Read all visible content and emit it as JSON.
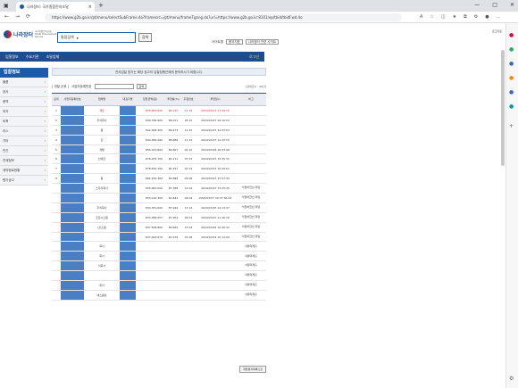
{
  "browser": {
    "tab_title": "나라장터: 국가종합전자조달",
    "url": "https://www.g2b.go.kr/pt/menu/selectSubFrame.do?framesrc=/pt/menu/frameTgong.do?url=https://www.g2b.go.kr:8101/ep/tbid/tbidFwd.do"
  },
  "header": {
    "logo_name": "나라장터",
    "logo_sub": "국가종합전자조달 Public Procurement Service",
    "search_option": "통합검색",
    "search_button": "검색",
    "logout": "로그아웃",
    "site_label": "·사이트맵",
    "site_select1": "용국지표",
    "site_select2": "나라장터 관련 사이트"
  },
  "nav": {
    "items": [
      "입찰정보",
      "수요기관",
      "조달업체"
    ],
    "right": "로그인"
  },
  "sidebar": {
    "title": "입찰정보",
    "items": [
      "물품",
      "공사",
      "용역",
      "외자",
      "비축",
      "리스",
      "기타",
      "민간",
      "연계정보",
      "계약완료현황",
      "평가공고"
    ]
  },
  "notice": "전자입찰 참가는 해당 공고의 입찰집행관에게 문의하시기 바랍니다.",
  "toolbar": {
    "sort_label": "[ 개찰 순위 ]",
    "filter_label": "사업자등록번호",
    "search_btn": "검색",
    "count_label": "[검색건수 : 20건]"
  },
  "table": {
    "headers": [
      "순위",
      "사업자등록번호",
      "업체명",
      "대표자명",
      "입찰금액(원)",
      "투찰률(%)",
      "추첨번호",
      "투찰일시",
      "비고"
    ],
    "rows": [
      {
        "rank": "1",
        "reg": "",
        "firm": "계토",
        "rep": "",
        "amt": "835,823,000",
        "rate": "86.125",
        "lot": "11 15",
        "date": "2024/03/27 17:49:15",
        "note": ""
      },
      {
        "rank": "2",
        "reg": "",
        "firm": "주식회사",
        "rep": "",
        "amt": "840,780,900",
        "rate": "86.011",
        "lot": "05 12",
        "date": "2024/03/27 16:10:03",
        "note": ""
      },
      {
        "rank": "3",
        "reg": "",
        "firm": "원",
        "rep": "",
        "amt": "842,306,300",
        "rate": "86.473",
        "lot": "12 15",
        "date": "2024/03/27 12:53:03",
        "note": ""
      },
      {
        "rank": "4",
        "reg": "",
        "firm": "단",
        "rep": "",
        "amt": "844,384,290",
        "rate": "86.686",
        "lot": "11 15",
        "date": "2024/03/27 11:32:15",
        "note": ""
      },
      {
        "rank": "5",
        "reg": "",
        "firm": "개발",
        "rep": "",
        "amt": "855,914,800",
        "rate": "89.607",
        "lot": "02 10",
        "date": "2024/03/26 16:53:48",
        "note": ""
      },
      {
        "rank": "6",
        "reg": "",
        "firm": "산에프",
        "rep": "",
        "amt": "876,975,700",
        "rate": "82.111",
        "lot": "07 01",
        "date": "2024/03/27 13:25:31",
        "note": ""
      },
      {
        "rank": "7",
        "reg": "",
        "firm": "",
        "rep": "",
        "amt": "878,632,194",
        "rate": "82.327",
        "lot": "03 12",
        "date": "2024/03/27 10:29:01",
        "note": ""
      },
      {
        "rank": "8",
        "reg": "",
        "firm": "종",
        "rep": "",
        "amt": "881,632,300",
        "rate": "82.688",
        "lot": "05 06",
        "date": "2024/03/27 15:57:32",
        "note": ""
      },
      {
        "rank": "",
        "reg": "",
        "firm": "스주식회사",
        "rep": "",
        "amt": "835,997,000",
        "rate": "87.788",
        "lot": "12 04",
        "date": "2024/03/27 13:25:45",
        "note": "낙찰하한선 미달"
      },
      {
        "rank": "",
        "reg": "",
        "firm": "",
        "rep": "",
        "amt": "833,110,300",
        "rate": "81.824",
        "lot": "09 04",
        "date": "2024/03/27 20:37:30:43",
        "note": "낙찰하한선 미달"
      },
      {
        "rank": "",
        "reg": "",
        "firm": "주식회사",
        "rep": "",
        "amt": "833,351,600",
        "rate": "87.949",
        "lot": "15 14",
        "date": "2024/03/25 14:13:37",
        "note": "낙찰하한선 미달"
      },
      {
        "rank": "",
        "reg": "",
        "firm": "프로시스템",
        "rep": "",
        "amt": "833,358,557",
        "rate": "87.954",
        "lot": "06 03",
        "date": "2024/03/27 11:30:16",
        "note": "낙찰하한선 미달"
      },
      {
        "rank": "",
        "reg": "",
        "firm": "[신스템",
        "rep": "",
        "amt": "837,508,860",
        "rate": "80.969",
        "lot": "15 04",
        "date": "2024/03/25 10:40:32",
        "note": "낙찰하한선 미달"
      },
      {
        "rank": "",
        "reg": "",
        "firm": "",
        "rep": "",
        "amt": "837,623,670",
        "rate": "81.978",
        "lot": "07 06",
        "date": "2024/03/22 10:14:09",
        "note": "낙찰하한선 미달"
      },
      {
        "rank": "",
        "reg": "",
        "firm": "회사",
        "rep": "",
        "amt": "",
        "rate": "",
        "lot": "",
        "date": "",
        "note": "서류미제출"
      },
      {
        "rank": "",
        "reg": "",
        "firm": "회사",
        "rep": "",
        "amt": "",
        "rate": "",
        "lot": "",
        "date": "",
        "note": "서류미제출"
      },
      {
        "rank": "",
        "reg": "",
        "firm": "식회사",
        "rep": "",
        "amt": "",
        "rate": "",
        "lot": "",
        "date": "",
        "note": "서류미제출"
      },
      {
        "rank": "",
        "reg": "",
        "firm": "",
        "rep": "",
        "amt": "",
        "rate": "",
        "lot": "",
        "date": "",
        "note": "서류미제출"
      },
      {
        "rank": "",
        "reg": "",
        "firm": "회사",
        "rep": "",
        "amt": "",
        "rate": "",
        "lot": "",
        "date": "",
        "note": "서류미제출"
      },
      {
        "rank": "",
        "reg": "",
        "firm": "에스콤상",
        "rep": "",
        "amt": "",
        "rate": "",
        "lot": "",
        "date": "",
        "note": "서류미제출"
      }
    ]
  },
  "footer_button": "개찰결과목록으로"
}
